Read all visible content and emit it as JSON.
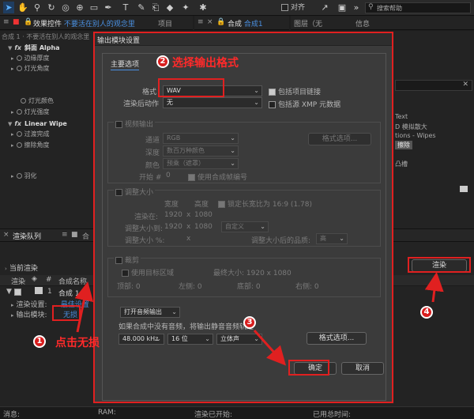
{
  "toolbar": {
    "snap_label": "对齐",
    "search_placeholder": "搜索帮助"
  },
  "tabs": {
    "effects_prefix": "效果控件",
    "effects_name": "不要活在别人的观念里",
    "project": "项目",
    "comp_prefix": "合成",
    "comp_name": "合成1",
    "layer": "图层（无",
    "info": "信息"
  },
  "effects_panel": {
    "header": "合成 1 · 不要活在别人的观念里",
    "rows": [
      {
        "label": "斜面 Alpha",
        "type": "fx"
      },
      {
        "label": "边缘厚度",
        "type": "prop"
      },
      {
        "label": "灯光角度",
        "type": "prop"
      },
      {
        "label": "灯光颜色",
        "type": "prop"
      },
      {
        "label": "灯光强度",
        "type": "prop"
      },
      {
        "label": "Linear Wipe",
        "type": "fx"
      },
      {
        "label": "过渡完成",
        "type": "prop"
      },
      {
        "label": "擦除角度",
        "type": "prop"
      },
      {
        "label": "羽化",
        "type": "prop"
      }
    ]
  },
  "right_panel": {
    "lines": [
      "Text",
      "D 模拟散大",
      "tions - Wipes",
      "擦除",
      "凸槽"
    ]
  },
  "render_queue": {
    "tab": "渲染队列",
    "tab2": "合",
    "current_render": "当前渲染",
    "render_button": "渲染",
    "columns": {
      "render": "渲染",
      "hash": "#",
      "comp_name": "合成名称"
    },
    "item_number": "1",
    "item_name": "合成 1",
    "render_settings_label": "渲染设置:",
    "render_settings_value": "最佳设置",
    "output_module_label": "输出模块:",
    "output_module_value": "无损"
  },
  "status": {
    "message": "消息:",
    "ram": "RAM:",
    "render_started": "渲染已开始:",
    "total_time": "已用总时间:"
  },
  "dialog": {
    "title": "输出模块设置",
    "tab_main": "主要选项",
    "tab_other": "色",
    "format_label": "格式",
    "format_value": "WAV",
    "post_render_label": "渲染后动作",
    "post_render_value": "无",
    "include_project_link": "包括项目链接",
    "include_xmp": "包括源 XMP 元数据",
    "video_output": "视频输出",
    "channels_label": "通道",
    "channels_value": "RGB",
    "depth_label": "深度",
    "depth_value": "数百万种颜色",
    "color_label": "颜色",
    "color_value": "预乘（遮罩）",
    "start_label": "开始 #",
    "start_value": "0",
    "use_comp_frame": "使用合成帧编号",
    "format_options": "格式选项...",
    "resize": "调整大小",
    "width_label": "宽度",
    "height_label": "高度",
    "lock_ratio": "锁定长宽比为 16:9 (1.78)",
    "render_at_label": "渲染在:",
    "render_at_w": "1920",
    "render_at_h": "1080",
    "resize_to_label": "调整大小到:",
    "resize_to_w": "1920",
    "resize_to_h": "1080",
    "custom_value": "自定义",
    "resize_pct_label": "调整大小 %:",
    "resize_quality_label": "调整大小后的品质:",
    "resize_quality_value": "高",
    "crop": "裁剪",
    "use_roi": "使用目标区域",
    "final_size": "最终大小: 1920 x 1080",
    "top_label": "顶部:",
    "top_value": "0",
    "left_label": "左侧:",
    "left_value": "0",
    "bottom_label": "底部:",
    "bottom_value": "0",
    "right_label": "右侧:",
    "right_value": "0",
    "x_sep": "x",
    "audio_output": "打开音频输出",
    "audio_hint": "如果合成中没有音频，将输出静音音频轨道",
    "sample_rate": "48.000 kHz",
    "bit_depth": "16 位",
    "channels_audio": "立体声",
    "audio_format_options": "格式选项...",
    "ok": "确定",
    "cancel": "取消"
  },
  "annotations": {
    "a1_num": "1",
    "a1_text": "点击无损",
    "a2_num": "2",
    "a2_text": "选择输出格式",
    "a3_num": "3",
    "a4_num": "4"
  },
  "colors": {
    "annotation_red": "#e02020",
    "link_blue": "#4a90e2"
  }
}
